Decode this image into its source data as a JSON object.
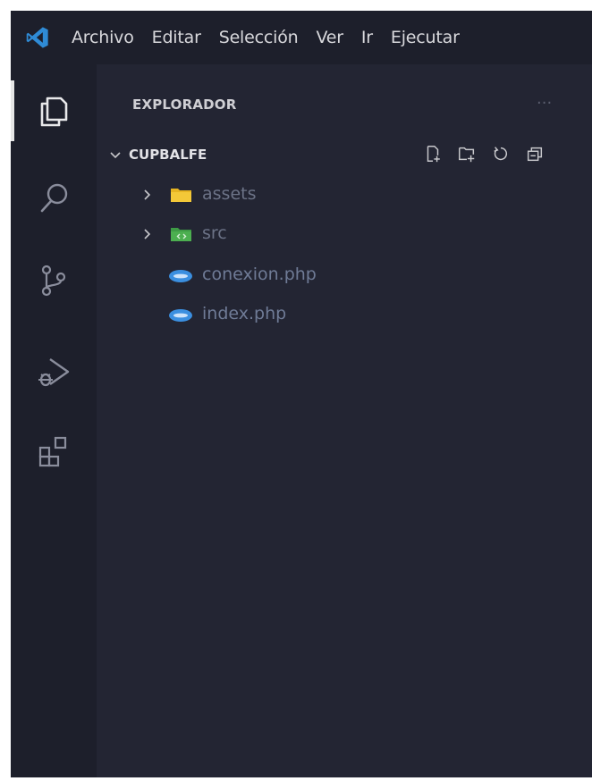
{
  "menubar": {
    "items": [
      "Archivo",
      "Editar",
      "Selección",
      "Ver",
      "Ir",
      "Ejecutar"
    ]
  },
  "activity": {
    "icons": [
      "explorer-icon",
      "search-icon",
      "source-control-icon",
      "run-debug-icon",
      "extensions-icon"
    ]
  },
  "sidebar": {
    "title": "EXPLORADOR",
    "more": "...",
    "folder": {
      "name": "CUPBALFE",
      "actions": [
        "new-file-icon",
        "new-folder-icon",
        "refresh-icon",
        "collapse-all-icon"
      ]
    },
    "tree": [
      {
        "label": "assets",
        "type": "folder"
      },
      {
        "label": "src",
        "type": "folder"
      },
      {
        "label": "conexion.php",
        "type": "file"
      },
      {
        "label": "index.php",
        "type": "file"
      }
    ]
  },
  "colors": {
    "background": "#232533",
    "bars": "#1d1f2b",
    "vscode_blue": "#2f8bd6",
    "assets_folder": "#e6b422",
    "src_folder": "#4caf50",
    "php_icon": "#3b8fe0"
  }
}
